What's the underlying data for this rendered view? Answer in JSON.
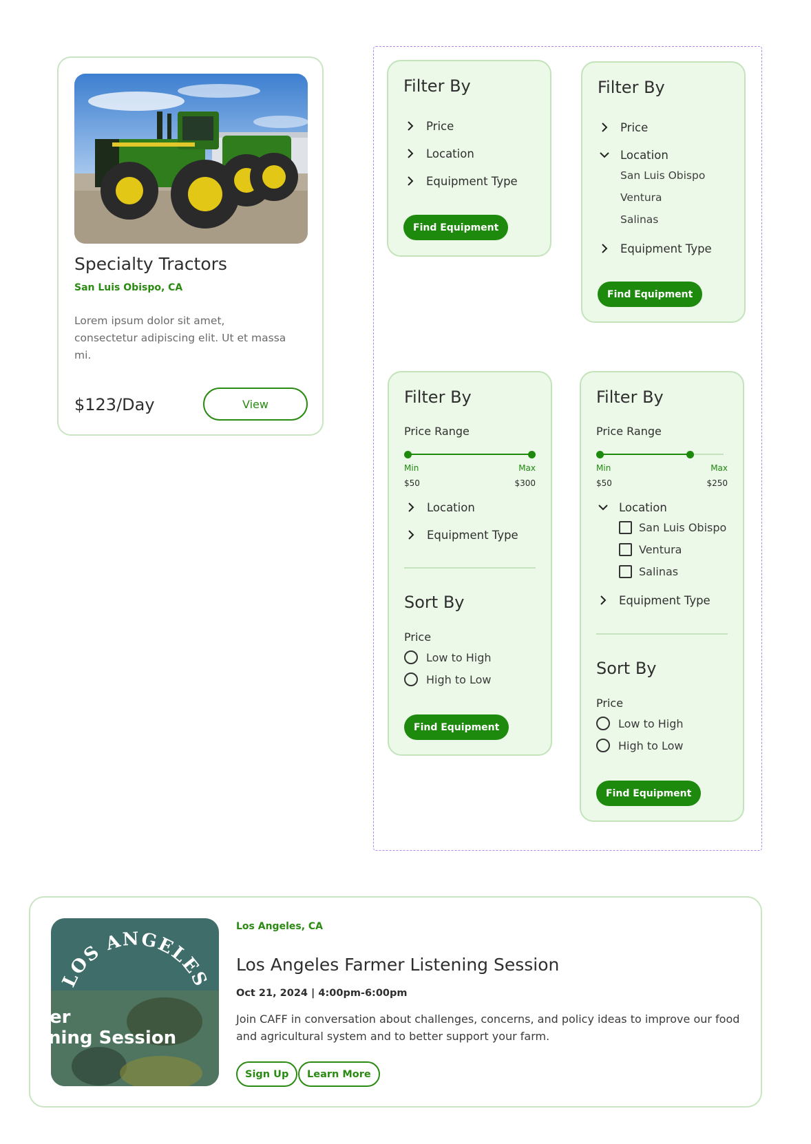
{
  "product_card": {
    "title": "Specialty Tractors",
    "location": "San Luis Obispo, CA",
    "description": "Lorem ipsum dolor sit amet, consectetur adipiscing elit. Ut et massa mi.",
    "price": "$123/Day",
    "view_label": "View"
  },
  "filter_panels": [
    {
      "heading": "Filter By",
      "items": [
        "Price",
        "Location",
        "Equipment Type"
      ],
      "button": "Find Equipment"
    },
    {
      "heading": "Filter By",
      "items": [
        "Price",
        "Location",
        "Equipment Type"
      ],
      "location_options": [
        "San Luis Obispo",
        "Ventura",
        "Salinas"
      ],
      "button": "Find Equipment"
    },
    {
      "heading": "Filter By",
      "price_range_label": "Price Range",
      "slider": {
        "min_label": "Min",
        "max_label": "Max",
        "min_value": "$50",
        "max_value": "$300",
        "low_fraction": 0,
        "high_fraction": 1
      },
      "items": [
        "Location",
        "Equipment Type"
      ],
      "sort_heading": "Sort By",
      "sort_label": "Price",
      "sort_options": [
        "Low to High",
        "High to Low"
      ],
      "button": "Find Equipment"
    },
    {
      "heading": "Filter By",
      "price_range_label": "Price Range",
      "slider": {
        "min_label": "Min",
        "max_label": "Max",
        "min_value": "$50",
        "max_value": "$250",
        "low_fraction": 0,
        "high_fraction": 0.73
      },
      "items": [
        "Location",
        "Equipment Type"
      ],
      "location_options": [
        "San Luis Obispo",
        "Ventura",
        "Salinas"
      ],
      "sort_heading": "Sort By",
      "sort_label": "Price",
      "sort_options": [
        "Low to High",
        "High to Low"
      ],
      "button": "Find Equipment"
    }
  ],
  "event_card": {
    "location": "Los Angeles, CA",
    "title": "Los Angeles Farmer Listening Session",
    "date": "Oct 21, 2024 | 4:00pm-6:00pm",
    "description": "Join CAFF in conversation about challenges, concerns, and policy ideas to improve our food and agricultural system and to better support your farm.",
    "image_text": {
      "arc": "LOS ANGELES",
      "line1": "er",
      "line2": "ning Session"
    },
    "signup_label": "Sign Up",
    "learn_more_label": "Learn More"
  },
  "colors": {
    "accent": "#1d8a0d",
    "panel_bg": "#ecf8e8",
    "border": "#c3e3bb",
    "dashed_border": "#a98be6"
  },
  "icons": [
    "chevron-right-icon",
    "chevron-down-icon",
    "radio-icon",
    "checkbox-icon"
  ]
}
